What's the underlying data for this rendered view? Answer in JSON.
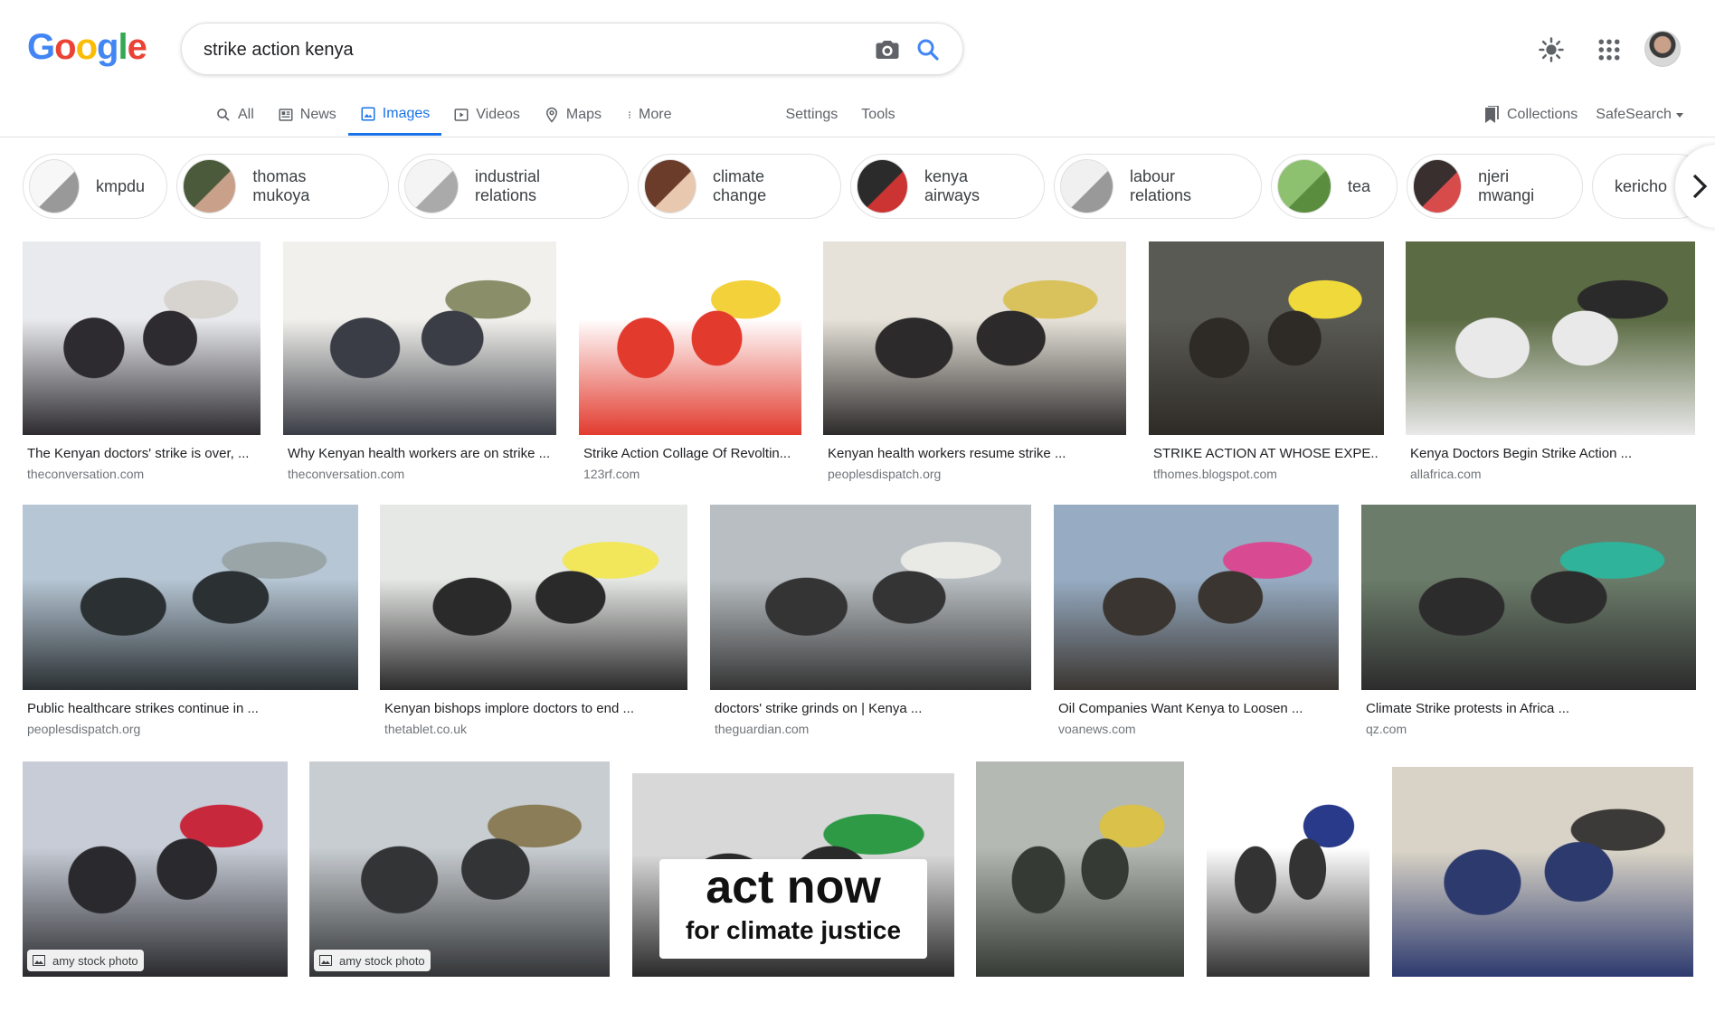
{
  "logo": {
    "letters": [
      "G",
      "o",
      "o",
      "g",
      "l",
      "e"
    ]
  },
  "search": {
    "query": "strike action kenya"
  },
  "tabs": [
    {
      "label": "All",
      "icon": "search-icon"
    },
    {
      "label": "News",
      "icon": "news-icon"
    },
    {
      "label": "Images",
      "icon": "image-icon",
      "active": true
    },
    {
      "label": "Videos",
      "icon": "video-icon"
    },
    {
      "label": "Maps",
      "icon": "map-pin-icon"
    },
    {
      "label": "More",
      "icon": "more-vert-icon"
    },
    {
      "label": "Settings"
    },
    {
      "label": "Tools"
    }
  ],
  "right_tabs": {
    "collections": "Collections",
    "safesearch": "SafeSearch"
  },
  "chips": [
    "kmpdu",
    "thomas mukoya",
    "industrial relations",
    "climate change",
    "kenya airways",
    "labour relations",
    "tea",
    "njeri mwangi",
    "kericho"
  ],
  "results": [
    {
      "title": "The Kenyan doctors' strike is over, ...",
      "source": "theconversation.com",
      "colors": [
        "#e9eaee",
        "#2d2b2f",
        "#d7d4d0"
      ]
    },
    {
      "title": "Why Kenyan health workers are on strike ...",
      "source": "theconversation.com",
      "colors": [
        "#f1f0ec",
        "#3a3d45",
        "#8a8f6a"
      ]
    },
    {
      "title": "Strike Action Collage Of Revoltin...",
      "source": "123rf.com",
      "colors": [
        "#ffffff",
        "#e23b2e",
        "#f2d13b"
      ]
    },
    {
      "title": "Kenyan health workers resume strike ...",
      "source": "peoplesdispatch.org",
      "colors": [
        "#e6e2d9",
        "#2c2a2a",
        "#d9c25c"
      ]
    },
    {
      "title": "STRIKE ACTION AT WHOSE EXPE...",
      "source": "tfhomes.blogspot.com",
      "colors": [
        "#5a5a54",
        "#2e2b27",
        "#f0d93a"
      ]
    },
    {
      "title": "Kenya Doctors Begin Strike Action ...",
      "source": "allafrica.com",
      "colors": [
        "#5b6b43",
        "#e9e9e9",
        "#2a2a2a"
      ]
    },
    {
      "title": "Public healthcare strikes continue in ...",
      "source": "peoplesdispatch.org",
      "colors": [
        "#b6c6d4",
        "#2b3033",
        "#9aa5a8"
      ]
    },
    {
      "title": "Kenyan bishops implore doctors to end ...",
      "source": "thetablet.co.uk",
      "colors": [
        "#e6e8e6",
        "#2a2a2a",
        "#f2e65a"
      ]
    },
    {
      "title": "doctors' strike grinds on | Kenya ...",
      "source": "theguardian.com",
      "colors": [
        "#b8bec2",
        "#343434",
        "#e9e9e6"
      ]
    },
    {
      "title": "Oil Companies Want Kenya to Loosen ...",
      "source": "voanews.com",
      "colors": [
        "#97acc3",
        "#3a3530",
        "#d84b93"
      ]
    },
    {
      "title": "Climate Strike protests in Africa ...",
      "source": "qz.com",
      "colors": [
        "#6b7c6a",
        "#2c2c2c",
        "#2fb39a"
      ]
    },
    {
      "title": "",
      "source": "",
      "badge": "amy stock photo",
      "colors": [
        "#c7ccd6",
        "#2a2a2e",
        "#c8283c"
      ]
    },
    {
      "title": "",
      "source": "",
      "badge": "amy stock photo",
      "colors": [
        "#c8cdd1",
        "#323436",
        "#8a7d58"
      ]
    },
    {
      "title": "",
      "source": "",
      "sign_text": "act now",
      "sign_sub": "for climate justice",
      "colors": [
        "#d8d8d8",
        "#2a2a2a",
        "#2f9a45"
      ]
    },
    {
      "title": "",
      "source": "",
      "colors": [
        "#b5b9b3",
        "#353a35",
        "#d9c14a"
      ]
    },
    {
      "title": "",
      "source": "",
      "colors": [
        "#ffffff",
        "#333333",
        "#2a3a8a"
      ]
    },
    {
      "title": "",
      "source": "",
      "colors": [
        "#d8d3c6",
        "#2d3a6e",
        "#3c3a38"
      ]
    }
  ]
}
